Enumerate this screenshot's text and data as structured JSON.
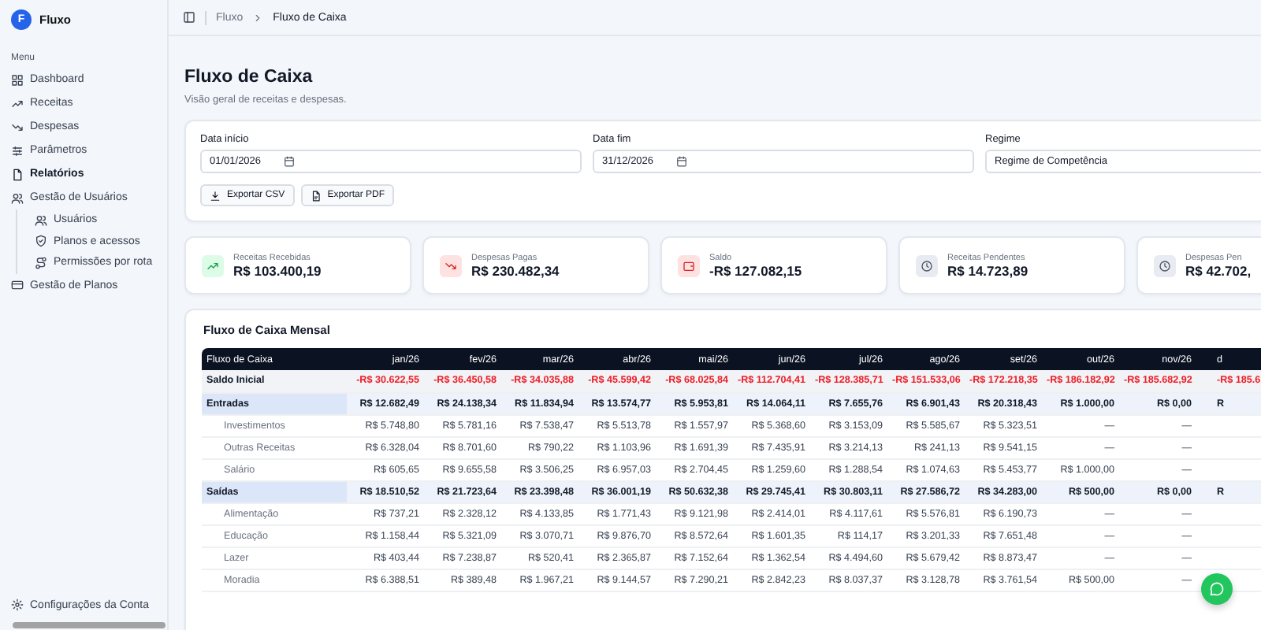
{
  "app": {
    "logo_letter": "F",
    "name": "Fluxo"
  },
  "sidebar": {
    "section": "Menu",
    "items": [
      {
        "label": "Dashboard",
        "kind": "grid",
        "selected": false
      },
      {
        "label": "Receitas",
        "kind": "up",
        "selected": false
      },
      {
        "label": "Despesas",
        "kind": "down",
        "selected": false
      },
      {
        "label": "Parâmetros",
        "kind": "sliders",
        "selected": false
      },
      {
        "label": "Relatórios",
        "kind": "file",
        "selected": true
      },
      {
        "label": "Gestão de Usuários",
        "kind": "users",
        "selected": false,
        "expanded": true,
        "children": [
          {
            "label": "Usuários",
            "kind": "users",
            "selected": false
          },
          {
            "label": "Planos e acessos",
            "kind": "shield",
            "selected": false
          },
          {
            "label": "Permissões por rota",
            "kind": "route",
            "selected": false
          }
        ]
      },
      {
        "label": "Gestão de Planos",
        "kind": "card",
        "selected": false
      }
    ],
    "footer": {
      "label": "Configurações da Conta",
      "kind": "gear"
    }
  },
  "breadcrumb": [
    "Fluxo",
    "Fluxo de Caixa"
  ],
  "page": {
    "title": "Fluxo de Caixa",
    "subtitle": "Visão geral de receitas e despesas."
  },
  "filters": [
    {
      "label": "Data início",
      "value": "01/01/2026",
      "kind": "date"
    },
    {
      "label": "Data fim",
      "value": "31/12/2026",
      "kind": "date"
    },
    {
      "label": "Regime",
      "value": "Regime de Competência",
      "kind": "select"
    }
  ],
  "exports": [
    {
      "label": "Exportar CSV",
      "kind": "download"
    },
    {
      "label": "Exportar PDF",
      "kind": "pdf"
    }
  ],
  "summary": [
    {
      "label": "Receitas Recebidas",
      "value": "R$ 103.400,19",
      "kind": "up"
    },
    {
      "label": "Despesas Pagas",
      "value": "R$ 230.482,34",
      "kind": "down"
    },
    {
      "label": "Saldo",
      "value": "-R$ 127.082,15",
      "kind": "wallet"
    },
    {
      "label": "Receitas Pendentes",
      "value": "R$ 14.723,89",
      "kind": "clock"
    },
    {
      "label": "Despesas Pen",
      "value": "R$ 42.702,",
      "kind": "clock"
    }
  ],
  "table": {
    "title": "Fluxo de Caixa Mensal",
    "columns": [
      "Fluxo de Caixa",
      "jan/26",
      "fev/26",
      "mar/26",
      "abr/26",
      "mai/26",
      "jun/26",
      "jul/26",
      "ago/26",
      "set/26",
      "out/26",
      "nov/26",
      "d"
    ],
    "rows": [
      {
        "kind": "balance",
        "label": "Saldo Inicial",
        "values": [
          "-R$ 30.622,55",
          "-R$ 36.450,58",
          "-R$ 34.035,88",
          "-R$ 45.599,42",
          "-R$ 68.025,84",
          "-R$ 112.704,41",
          "-R$ 128.385,71",
          "-R$ 151.533,06",
          "-R$ 172.218,35",
          "-R$ 186.182,92",
          "-R$ 185.682,92",
          "-R$ 185.6"
        ]
      },
      {
        "kind": "group",
        "label": "Entradas",
        "values": [
          "R$ 12.682,49",
          "R$ 24.138,34",
          "R$ 11.834,94",
          "R$ 13.574,77",
          "R$ 5.953,81",
          "R$ 14.064,11",
          "R$ 7.655,76",
          "R$ 6.901,43",
          "R$ 20.318,43",
          "R$ 1.000,00",
          "R$ 0,00",
          "R"
        ]
      },
      {
        "kind": "item",
        "label": "Investimentos",
        "values": [
          "R$ 5.748,80",
          "R$ 5.781,16",
          "R$ 7.538,47",
          "R$ 5.513,78",
          "R$ 1.557,97",
          "R$ 5.368,60",
          "R$ 3.153,09",
          "R$ 5.585,67",
          "R$ 5.323,51",
          "—",
          "—"
        ]
      },
      {
        "kind": "item",
        "label": "Outras Receitas",
        "values": [
          "R$ 6.328,04",
          "R$ 8.701,60",
          "R$ 790,22",
          "R$ 1.103,96",
          "R$ 1.691,39",
          "R$ 7.435,91",
          "R$ 3.214,13",
          "R$ 241,13",
          "R$ 9.541,15",
          "—",
          "—"
        ]
      },
      {
        "kind": "item",
        "label": "Salário",
        "values": [
          "R$ 605,65",
          "R$ 9.655,58",
          "R$ 3.506,25",
          "R$ 6.957,03",
          "R$ 2.704,45",
          "R$ 1.259,60",
          "R$ 1.288,54",
          "R$ 1.074,63",
          "R$ 5.453,77",
          "R$ 1.000,00",
          "—"
        ]
      },
      {
        "kind": "group",
        "label": "Saídas",
        "values": [
          "R$ 18.510,52",
          "R$ 21.723,64",
          "R$ 23.398,48",
          "R$ 36.001,19",
          "R$ 50.632,38",
          "R$ 29.745,41",
          "R$ 30.803,11",
          "R$ 27.586,72",
          "R$ 34.283,00",
          "R$ 500,00",
          "R$ 0,00",
          "R"
        ]
      },
      {
        "kind": "item",
        "label": "Alimentação",
        "values": [
          "R$ 737,21",
          "R$ 2.328,12",
          "R$ 4.133,85",
          "R$ 1.771,43",
          "R$ 9.121,98",
          "R$ 2.414,01",
          "R$ 4.117,61",
          "R$ 5.576,81",
          "R$ 6.190,73",
          "—",
          "—"
        ]
      },
      {
        "kind": "item",
        "label": "Educação",
        "values": [
          "R$ 1.158,44",
          "R$ 5.321,09",
          "R$ 3.070,71",
          "R$ 9.876,70",
          "R$ 8.572,64",
          "R$ 1.601,35",
          "R$ 114,17",
          "R$ 3.201,33",
          "R$ 7.651,48",
          "—",
          "—"
        ]
      },
      {
        "kind": "item",
        "label": "Lazer",
        "values": [
          "R$ 403,44",
          "R$ 7.238,87",
          "R$ 520,41",
          "R$ 2.365,87",
          "R$ 7.152,64",
          "R$ 1.362,54",
          "R$ 4.494,60",
          "R$ 5.679,42",
          "R$ 8.873,47",
          "—",
          "—"
        ]
      },
      {
        "kind": "item",
        "label": "Moradia",
        "values": [
          "R$ 6.388,51",
          "R$ 389,48",
          "R$ 1.967,21",
          "R$ 9.144,57",
          "R$ 7.290,21",
          "R$ 2.842,23",
          "R$ 8.037,37",
          "R$ 3.128,78",
          "R$ 3.761,54",
          "R$ 500,00",
          "—"
        ]
      }
    ]
  }
}
